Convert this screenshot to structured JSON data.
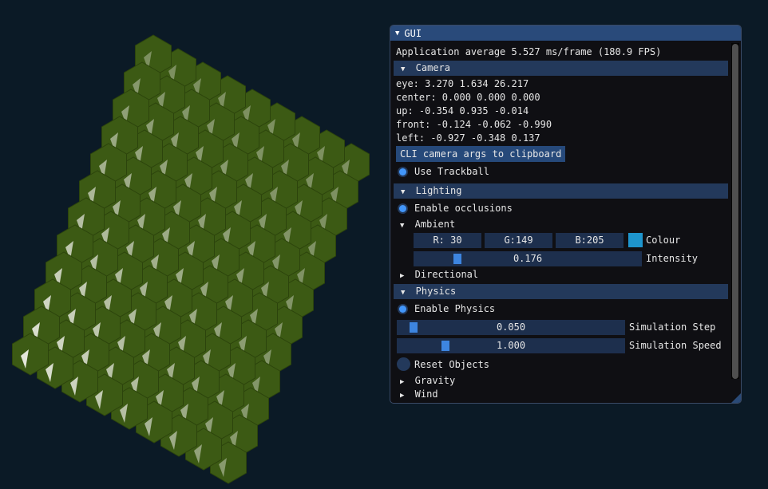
{
  "window": {
    "title": "GUI"
  },
  "stats": "Application average 5.527 ms/frame (180.9 FPS)",
  "camera": {
    "header": "Camera",
    "eye": "eye: 3.270 1.634 26.217",
    "center": "center: 0.000 0.000 0.000",
    "up": "up: -0.354 0.935 -0.014",
    "front": "front: -0.124 -0.062 -0.990",
    "left": "left: -0.927 -0.348 0.137",
    "clipboard_button": "CLI camera args to clipboard",
    "use_trackball": {
      "label": "Use Trackball",
      "checked": true
    }
  },
  "lighting": {
    "header": "Lighting",
    "enable_occlusions": {
      "label": "Enable occlusions",
      "checked": true
    },
    "ambient": {
      "label": "Ambient",
      "r": "R: 30",
      "g": "G:149",
      "b": "B:205",
      "colour_label": "Colour",
      "colour_hex": "#1e95cd",
      "intensity_value": "0.176",
      "intensity_fraction": 0.176,
      "intensity_label": "Intensity"
    },
    "directional": "Directional"
  },
  "physics": {
    "header": "Physics",
    "enable_physics": {
      "label": "Enable Physics",
      "checked": true
    },
    "step_value": "0.050",
    "step_fraction": 0.05,
    "step_label": "Simulation Step",
    "speed_value": "1.000",
    "speed_fraction": 0.2,
    "speed_label": "Simulation Speed",
    "reset_label": "Reset Objects",
    "gravity": "Gravity",
    "wind": "Wind"
  },
  "colors": {
    "background": "#0b1a26",
    "title_bar": "#294a7a",
    "header": "#23395b",
    "accent": "#4296fa",
    "object_green": "#3c5a14",
    "highlight": "#f5f5ef"
  }
}
